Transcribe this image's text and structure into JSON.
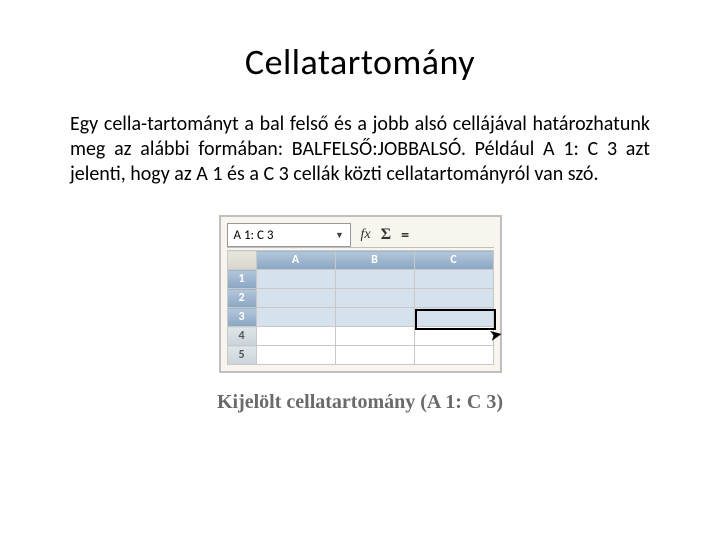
{
  "title": "Cellatartomány",
  "body": "Egy cella-tartományt a bal felső és a jobb alsó cellájával határozhatunk meg az alábbi formában: BALFELSŐ:JOBBALSÓ. Például A 1: C 3 azt jelenti, hogy az A 1 és a C 3 cellák közti cellatartományról van szó.",
  "sheet": {
    "namebox": "A 1: C 3",
    "fx": "fx",
    "sigma": "Σ",
    "eq": "=",
    "cols": [
      "A",
      "B",
      "C"
    ],
    "rows": [
      "1",
      "2",
      "3",
      "4",
      "5"
    ],
    "selected_cols": [
      0,
      1,
      2
    ],
    "selected_rows": [
      0,
      1,
      2
    ]
  },
  "caption": "Kijelölt cellatartomány (A 1: C 3)"
}
